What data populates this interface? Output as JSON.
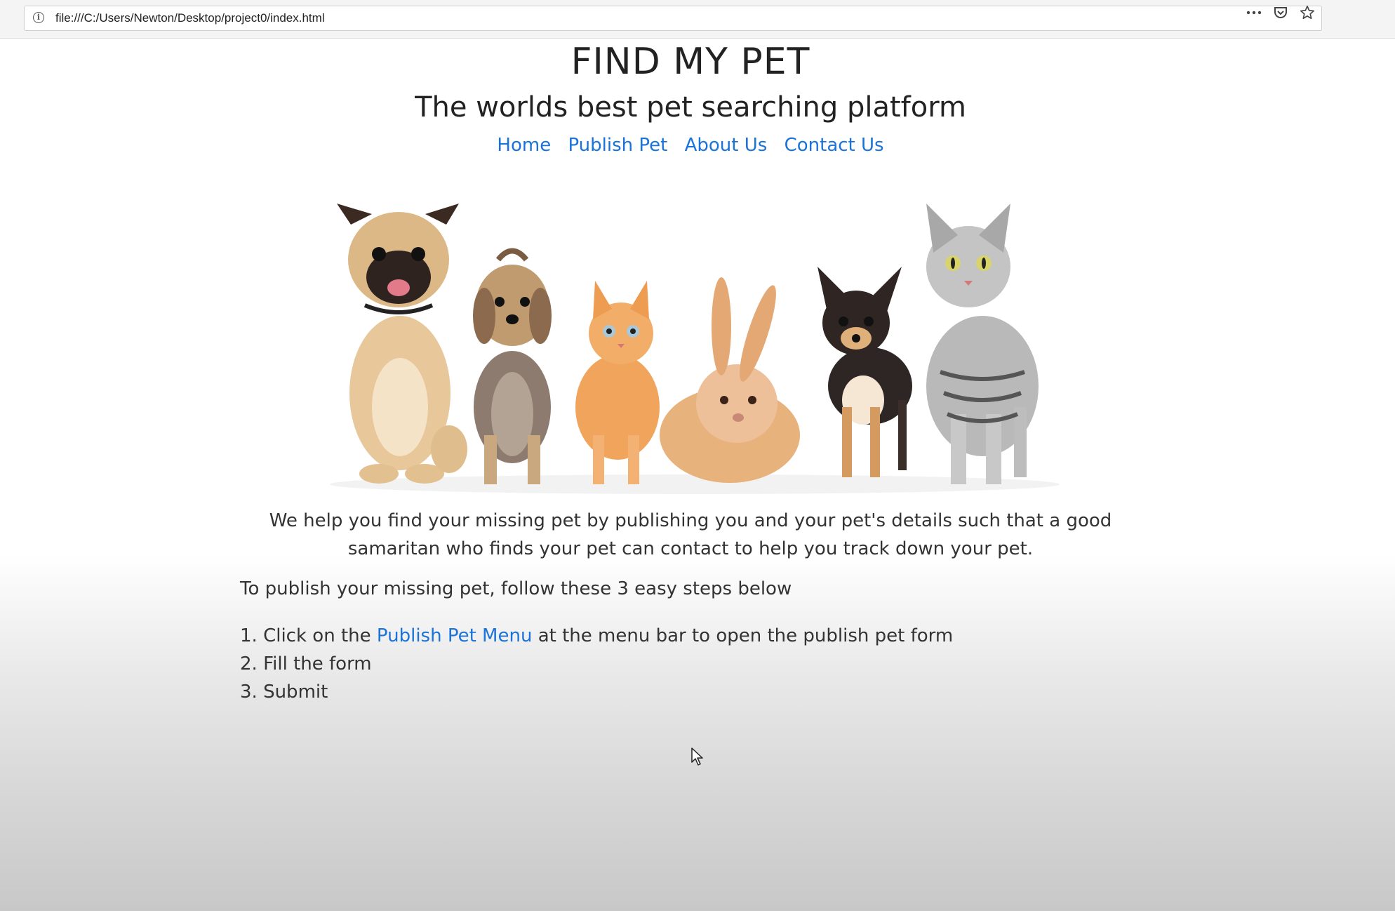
{
  "browser": {
    "url": "file:///C:/Users/Newton/Desktop/project0/index.html",
    "icons": [
      "info-icon",
      "more-icon",
      "pocket-icon",
      "bookmark-star-icon"
    ]
  },
  "header": {
    "title": "FIND MY PET",
    "subtitle": "The worlds best pet searching platform"
  },
  "nav": {
    "items": [
      {
        "label": "Home"
      },
      {
        "label": "Publish Pet"
      },
      {
        "label": "About Us"
      },
      {
        "label": "Contact Us"
      }
    ]
  },
  "hero": {
    "image": "pets-banner-image"
  },
  "content": {
    "intro": "We help you find your missing pet by publishing you and your pet's details such that a good samaritan who finds your pet can contact to help you track down your pet.",
    "steps_intro": "To publish your missing pet, follow these 3 easy steps below",
    "steps": [
      {
        "number": "1.",
        "pre": "Click on the ",
        "link": "Publish Pet Menu",
        "post": " at the menu bar to open the publish pet form"
      },
      {
        "number": "2.",
        "text": "Fill the form"
      },
      {
        "number": "3.",
        "text": "Submit"
      }
    ]
  },
  "colors": {
    "link": "#1a73d9",
    "text": "#2b2b2b"
  }
}
